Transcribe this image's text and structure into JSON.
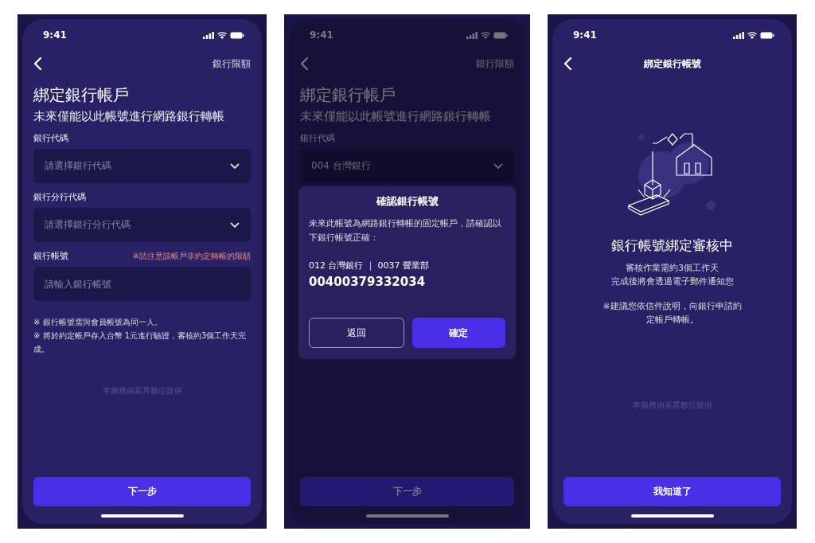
{
  "screens": [
    {
      "kind": "form",
      "time": "9:41",
      "nav_action": "銀行限額",
      "title": "綁定銀行帳戶",
      "subtitle": "未來僅能以此帳號進行網路銀行轉帳",
      "fields": [
        {
          "kind": "select",
          "label": "銀行代碼",
          "placeholder": "請選擇銀行代碼"
        },
        {
          "kind": "select",
          "label": "銀行分行代碼",
          "placeholder": "請選擇銀行分行代碼"
        },
        {
          "kind": "input",
          "label": "銀行帳號",
          "hint": "※請注意該帳戶非約定轉帳的限額",
          "placeholder": "請輸入銀行帳號"
        }
      ],
      "notes": [
        "※ 銀行帳號需與會員帳號為同一人。",
        "※ 將於約定帳戶存入台幣 1元進行驗證，審核約3個工作天完成。"
      ],
      "footer": "本服務由富昇數位提供",
      "button": "下一步"
    },
    {
      "kind": "form",
      "time": "9:41",
      "nav_action": "銀行限額",
      "title": "綁定銀行帳戶",
      "subtitle": "未來僅能以此帳號進行網路銀行轉帳",
      "fields": [
        {
          "kind": "select",
          "label": "銀行代碼",
          "value": "004 台灣銀行"
        }
      ],
      "button": "下一步",
      "dialog": {
        "title": "確認銀行帳號",
        "message": "未來此帳號為網路銀行轉帳的固定帳戶，請確認以下銀行帳號正確：",
        "bank_line": "012 台灣銀行 ｜ 0037 營業部",
        "account_number": "00400379332034",
        "buttons": [
          {
            "kind": "secondary",
            "label": "返回"
          },
          {
            "kind": "primary",
            "label": "確定"
          }
        ]
      }
    },
    {
      "kind": "result",
      "time": "9:41",
      "nav_title": "綁定銀行帳號",
      "heading": "銀行帳號綁定審核中",
      "lines": [
        "審核作業需約3個工作天",
        "完成後將會透過電子郵件通知您"
      ],
      "note": "※建議您依信件說明，向銀行申請約定帳戶轉帳。",
      "footer": "本服務由富昇數位提供",
      "button": "我知道了"
    }
  ]
}
